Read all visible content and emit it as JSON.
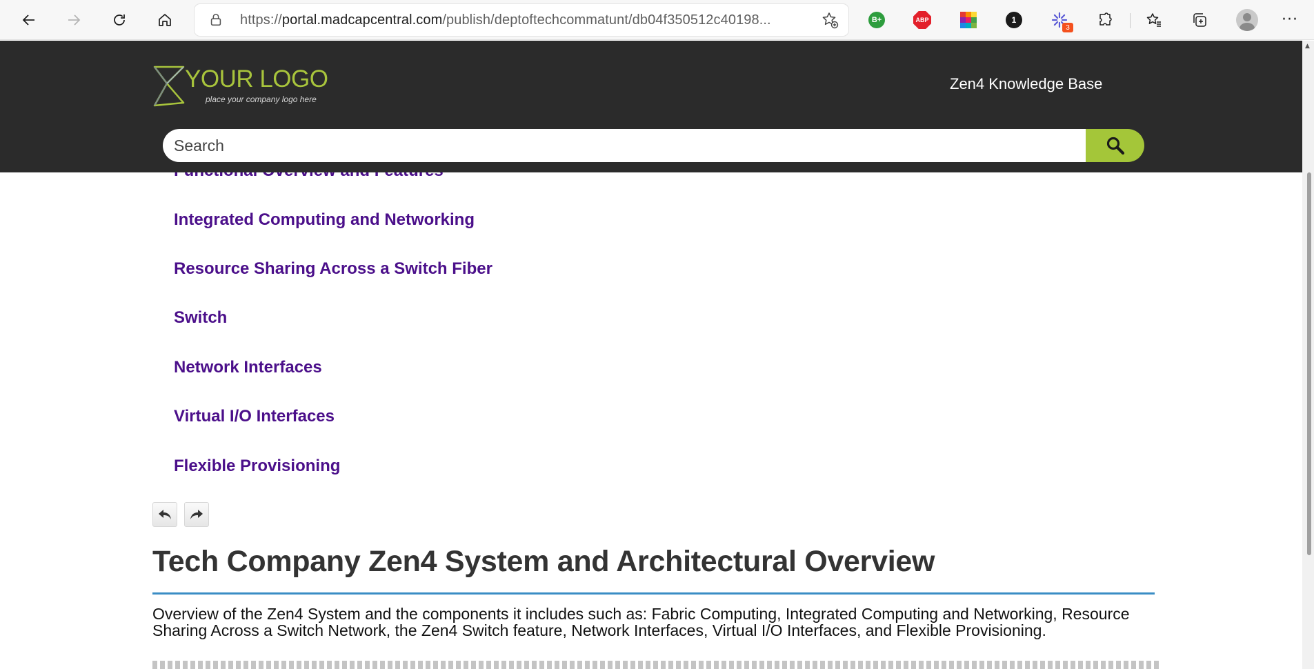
{
  "browser": {
    "url_prefix": "https://",
    "url_host": "portal.madcapcentral.com",
    "url_path": "/publish/deptoftechcommatunt/db04f350512c40198...",
    "extensions": [
      {
        "name": "bplus-extension-icon",
        "label": "B+"
      },
      {
        "name": "adblock-plus-icon",
        "label": "ABP"
      },
      {
        "name": "color-grid-extension-icon",
        "label": ""
      },
      {
        "name": "onepassword-extension-icon",
        "label": "1"
      },
      {
        "name": "spark-extension-icon",
        "badge": "3"
      }
    ],
    "menu_label": "···"
  },
  "header": {
    "logo_title": "YOUR LOGO",
    "logo_tagline": "place your company logo here",
    "kb_title": "Zen4 Knowledge Base",
    "search_placeholder": "Search"
  },
  "toc": {
    "items": [
      "Functional Overview and Features",
      "Integrated Computing and Networking",
      "Resource Sharing Across a Switch Fiber",
      "Switch",
      "Network Interfaces",
      "Virtual I/O Interfaces",
      "Flexible Provisioning"
    ]
  },
  "article": {
    "title": "Tech Company Zen4 System and Architectural Overview",
    "overview": "Overview of the Zen4 System and the components it includes such as: Fabric Computing, Integrated Computing and Networking, Resource Sharing Across a Switch Network, the Zen4 Switch feature, Network Interfaces, Virtual I/O Interfaces, and Flexible Provisioning."
  },
  "colors": {
    "header_bg": "#2b2b2b",
    "accent_green": "#a4c639",
    "link_purple": "#4b0f8a",
    "title_rule_blue": "#3a8dc5"
  }
}
